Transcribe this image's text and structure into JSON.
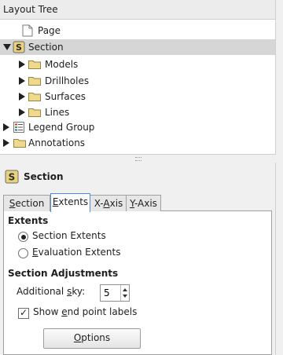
{
  "layout_tree": {
    "title": "Layout Tree",
    "items": [
      {
        "label": "Page"
      },
      {
        "label": "Section"
      },
      {
        "label": "Models"
      },
      {
        "label": "Drillholes"
      },
      {
        "label": "Surfaces"
      },
      {
        "label": "Lines"
      },
      {
        "label": "Legend Group"
      },
      {
        "label": "Annotations"
      }
    ],
    "selected": "Section"
  },
  "properties": {
    "title": "Section",
    "tabs": [
      {
        "label": "Section",
        "mnemonic": "S",
        "rest": "ection"
      },
      {
        "label": "Extents",
        "mnemonic": "E",
        "rest": "xtents"
      },
      {
        "label": "X-Axis",
        "pre": "X-",
        "mnemonic": "A",
        "rest": "xis"
      },
      {
        "label": "Y-Axis",
        "mnemonic": "Y",
        "rest": "-Axis"
      }
    ],
    "active_tab": "Extents",
    "extents": {
      "heading": "Extents",
      "options": [
        {
          "label": "Section Extents",
          "selected": true
        },
        {
          "label": "Evaluation Extents",
          "mnemonic": "E",
          "rest": "valuation Extents",
          "selected": false
        }
      ]
    },
    "adjustments": {
      "heading": "Section Adjustments",
      "sky_label_pre": "Additional ",
      "sky_label_mn": "s",
      "sky_label_post": "ky:",
      "sky_value": "5",
      "checkbox_pre": "Show ",
      "checkbox_mn": "e",
      "checkbox_post": "nd point labels",
      "checkbox_checked": true
    },
    "options_button": {
      "mnemonic": "O",
      "rest": "ptions"
    }
  },
  "colors": {
    "folder": "#e8cf7a",
    "selection": "#d6d6d6",
    "active_tab_border": "#4c8fd6"
  }
}
